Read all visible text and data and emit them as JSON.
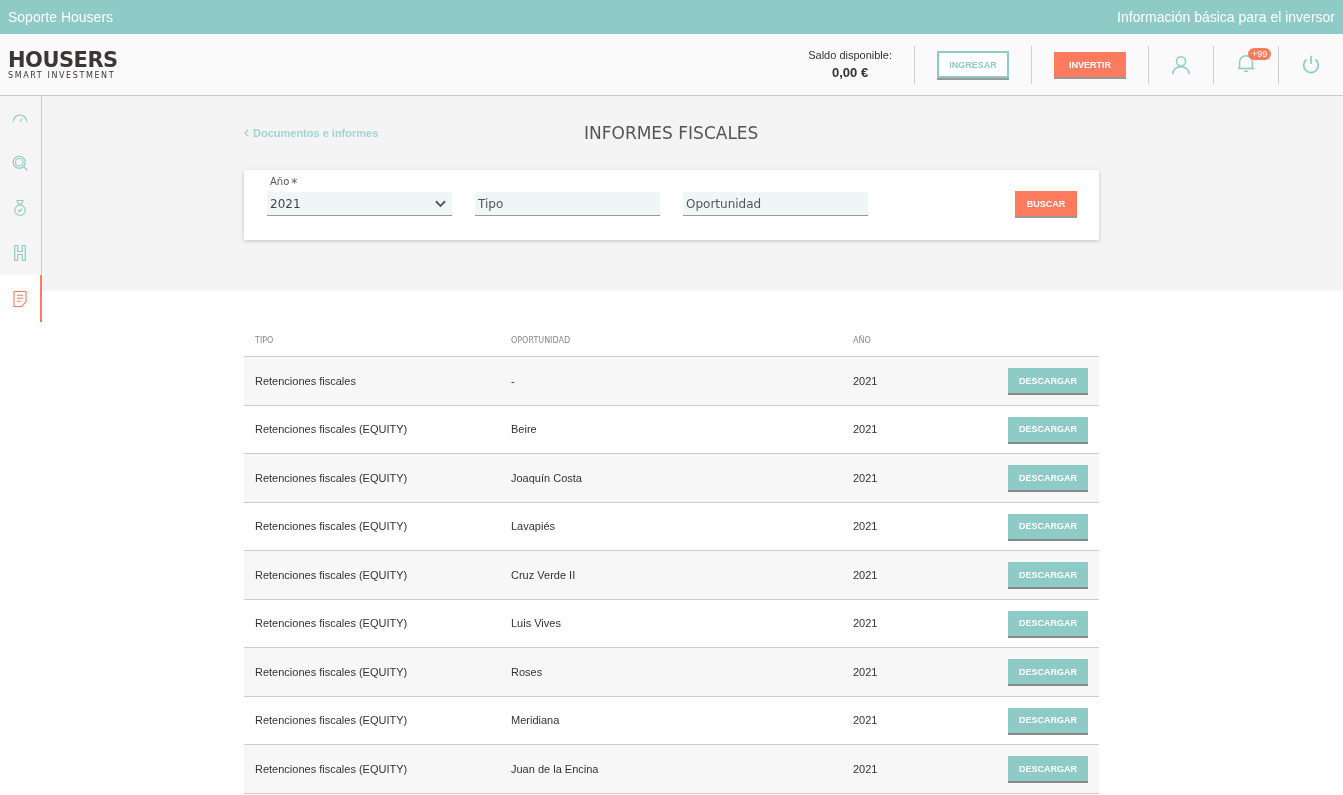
{
  "top_bar": {
    "left_link": "Soporte Housers",
    "right_link": "Información básica para el inversor"
  },
  "header": {
    "logo": {
      "name": "HOUSERS",
      "tagline": "SMART INVESTMENT"
    },
    "balance_label": "Saldo disponible:",
    "balance_value": "0,00 €",
    "deposit_button": "INGRESAR",
    "invest_button": "INVERTIR",
    "notification_badge": "+99"
  },
  "sidebar": {
    "items": [
      {
        "kind": "gauge",
        "selected": false
      },
      {
        "kind": "search",
        "selected": false
      },
      {
        "kind": "medal",
        "selected": false
      },
      {
        "kind": "letter",
        "selected": false
      },
      {
        "kind": "document",
        "selected": true
      }
    ]
  },
  "breadcrumb": "Documentos e informes",
  "page_title": "INFORMES FISCALES",
  "filters": {
    "year_label": "Año",
    "year_required": "*",
    "year_value": "2021",
    "type_placeholder": "Tipo",
    "opportunity_placeholder": "Oportunidad",
    "search_button": "BUSCAR"
  },
  "table": {
    "columns": [
      "TIPO",
      "OPORTUNIDAD",
      "AÑO"
    ],
    "rows": [
      {
        "type": "Retenciones fiscales",
        "opportunity": "-",
        "year": "2021",
        "action": "DESCARGAR"
      },
      {
        "type": "Retenciones fiscales (EQUITY)",
        "opportunity": "Beire",
        "year": "2021",
        "action": "DESCARGAR"
      },
      {
        "type": "Retenciones fiscales (EQUITY)",
        "opportunity": "Joaquín Costa",
        "year": "2021",
        "action": "DESCARGAR"
      },
      {
        "type": "Retenciones fiscales (EQUITY)",
        "opportunity": "Lavapiés",
        "year": "2021",
        "action": "DESCARGAR"
      },
      {
        "type": "Retenciones fiscales (EQUITY)",
        "opportunity": "Cruz Verde II",
        "year": "2021",
        "action": "DESCARGAR"
      },
      {
        "type": "Retenciones fiscales (EQUITY)",
        "opportunity": "Luis Vives",
        "year": "2021",
        "action": "DESCARGAR"
      },
      {
        "type": "Retenciones fiscales (EQUITY)",
        "opportunity": "Roses",
        "year": "2021",
        "action": "DESCARGAR"
      },
      {
        "type": "Retenciones fiscales (EQUITY)",
        "opportunity": "Meridiana",
        "year": "2021",
        "action": "DESCARGAR"
      },
      {
        "type": "Retenciones fiscales (EQUITY)",
        "opportunity": "Juan de la Encina",
        "year": "2021",
        "action": "DESCARGAR"
      }
    ]
  }
}
